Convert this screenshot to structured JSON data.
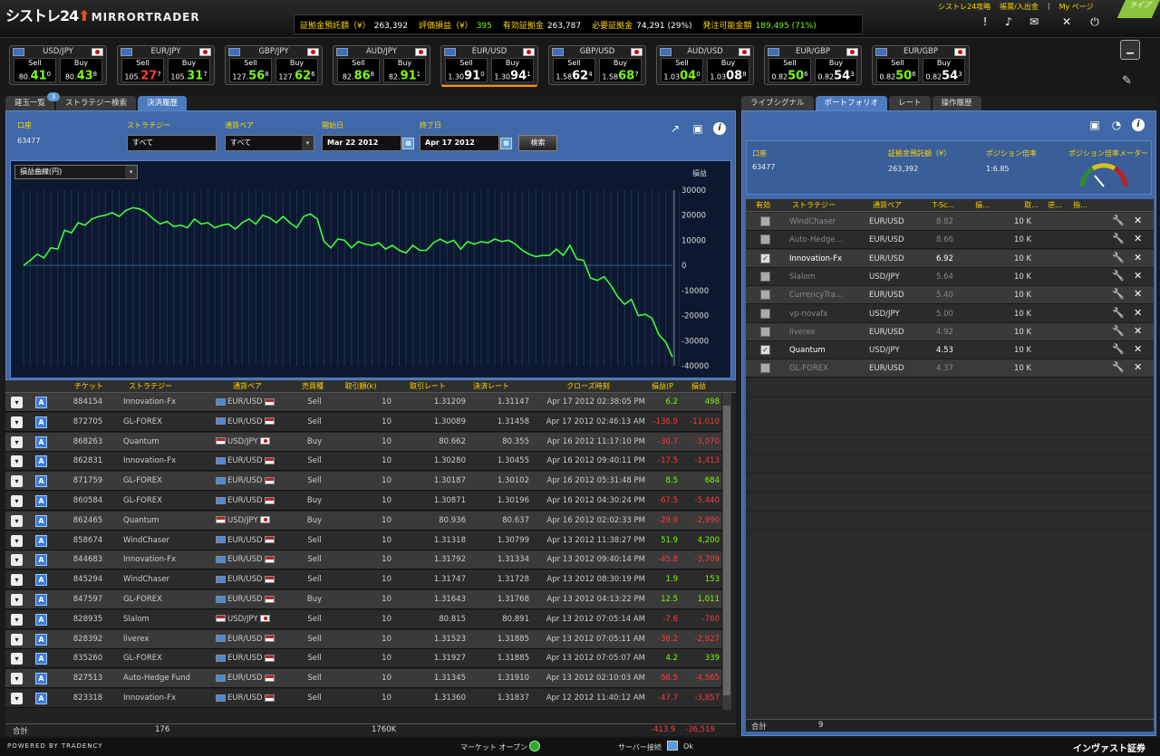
{
  "header": {
    "logo": "シストレ24",
    "logo_sub": "MIRRORTRADER",
    "account_bar": [
      {
        "label": "証拠金預託額（¥）",
        "value": "263,392",
        "green": false
      },
      {
        "label": "評価損益（¥）",
        "value": "395",
        "green": true
      },
      {
        "label": "有効証拠金",
        "value": "263,787",
        "green": false
      },
      {
        "label": "必要証拠金",
        "value": "74,291 (29%)",
        "green": false
      },
      {
        "label": "発注可能金額",
        "value": "189,495 (71%)",
        "green": true
      }
    ],
    "links": [
      "シストレ24攻略",
      "帳票/入出金",
      "|",
      "My ページ"
    ],
    "corner_flag": "ライブ"
  },
  "quotes": [
    {
      "pair": "USD/JPY",
      "sell_pre": "80.",
      "sell_big": "41",
      "sell_sup": "0",
      "buy_pre": "80.",
      "buy_big": "43",
      "buy_sup": "8",
      "sell_color": "g",
      "buy_color": "g",
      "active": false
    },
    {
      "pair": "EUR/JPY",
      "sell_pre": "105.",
      "sell_big": "27",
      "sell_sup": "7",
      "buy_pre": "105.",
      "buy_big": "31",
      "buy_sup": "7",
      "sell_color": "r",
      "buy_color": "g",
      "active": false
    },
    {
      "pair": "GBP/JPY",
      "sell_pre": "127.",
      "sell_big": "56",
      "sell_sup": "8",
      "buy_pre": "127.",
      "buy_big": "62",
      "buy_sup": "6",
      "sell_color": "g",
      "buy_color": "g",
      "active": false
    },
    {
      "pair": "AUD/JPY",
      "sell_pre": "82.",
      "sell_big": "86",
      "sell_sup": "8",
      "buy_pre": "82.",
      "buy_big": "91",
      "buy_sup": "1",
      "sell_color": "g",
      "buy_color": "g",
      "active": false
    },
    {
      "pair": "EUR/USD",
      "sell_pre": "1.30",
      "sell_big": "91",
      "sell_sup": "0",
      "buy_pre": "1.30",
      "buy_big": "94",
      "buy_sup": "1",
      "sell_color": "w",
      "buy_color": "w",
      "active": true
    },
    {
      "pair": "GBP/USD",
      "sell_pre": "1.58",
      "sell_big": "62",
      "sell_sup": "4",
      "buy_pre": "1.58",
      "buy_big": "68",
      "buy_sup": "7",
      "sell_color": "w",
      "buy_color": "g",
      "active": false
    },
    {
      "pair": "AUD/USD",
      "sell_pre": "1.03",
      "sell_big": "04",
      "sell_sup": "0",
      "buy_pre": "1.03",
      "buy_big": "08",
      "buy_sup": "8",
      "sell_color": "g",
      "buy_color": "w",
      "active": false
    },
    {
      "pair": "EUR/GBP",
      "sell_pre": "0.82",
      "sell_big": "50",
      "sell_sup": "6",
      "buy_pre": "0.82",
      "buy_big": "54",
      "buy_sup": "3",
      "sell_color": "g",
      "buy_color": "w",
      "active": false
    },
    {
      "pair": "EUR/GBP",
      "sell_pre": "0.82",
      "sell_big": "50",
      "sell_sup": "6",
      "buy_pre": "0.82",
      "buy_big": "54",
      "buy_sup": "3",
      "sell_color": "g",
      "buy_color": "w",
      "active": false
    }
  ],
  "left": {
    "tabs": [
      "建玉一覧",
      "ストラテジー検索",
      "決済履歴"
    ],
    "tab_badge": "3",
    "filter": {
      "account_label": "口座",
      "account": "63477",
      "strategy_label": "ストラテジー",
      "strategy": "すべて",
      "pair_label": "通貨ペア",
      "pair": "すべて",
      "start_label": "開始日",
      "start": "Mar 22 2012",
      "end_label": "終了日",
      "end": "Apr 17 2012",
      "search": "検索"
    },
    "chart_select": "損益曲線(円)",
    "chart_ylabel": "損益",
    "columns": [
      "チケット",
      "ストラテジー",
      "通貨ペア",
      "売買種",
      "取引額(k)",
      "取引レート",
      "決済レート",
      "クローズ時刻",
      "損益(P",
      "損益"
    ],
    "trades": [
      [
        "884154",
        "Innovation-Fx",
        "EUR/USD",
        "Sell",
        "10",
        "1.31209",
        "1.31147",
        "Apr 17 2012 02:38:05 PM",
        "6.2",
        "498"
      ],
      [
        "872705",
        "GL-FOREX",
        "EUR/USD",
        "Sell",
        "10",
        "1.30089",
        "1.31458",
        "Apr 17 2012 02:46:13 AM",
        "-136.9",
        "-11,010"
      ],
      [
        "868263",
        "Quantum",
        "USD/JPY",
        "Buy",
        "10",
        "80.662",
        "80.355",
        "Apr 16 2012 11:17:10 PM",
        "-30.7",
        "-3,070"
      ],
      [
        "862831",
        "Innovation-Fx",
        "EUR/USD",
        "Sell",
        "10",
        "1.30280",
        "1.30455",
        "Apr 16 2012 09:40:11 PM",
        "-17.5",
        "-1,413"
      ],
      [
        "871759",
        "GL-FOREX",
        "EUR/USD",
        "Sell",
        "10",
        "1.30187",
        "1.30102",
        "Apr 16 2012 05:31:48 PM",
        "8.5",
        "684"
      ],
      [
        "860584",
        "GL-FOREX",
        "EUR/USD",
        "Buy",
        "10",
        "1.30871",
        "1.30196",
        "Apr 16 2012 04:30:24 PM",
        "-67.5",
        "-5,440"
      ],
      [
        "862465",
        "Quantum",
        "USD/JPY",
        "Buy",
        "10",
        "80.936",
        "80.637",
        "Apr 16 2012 02:02:33 PM",
        "-29.9",
        "-2,990"
      ],
      [
        "858674",
        "WindChaser",
        "EUR/USD",
        "Sell",
        "10",
        "1.31318",
        "1.30799",
        "Apr 13 2012 11:38:27 PM",
        "51.9",
        "4,200"
      ],
      [
        "844683",
        "Innovation-Fx",
        "EUR/USD",
        "Sell",
        "10",
        "1.31792",
        "1.31334",
        "Apr 13 2012 09:40:14 PM",
        "-45.8",
        "-3,709"
      ],
      [
        "845294",
        "WindChaser",
        "EUR/USD",
        "Sell",
        "10",
        "1.31747",
        "1.31728",
        "Apr 13 2012 08:30:19 PM",
        "1.9",
        "153"
      ],
      [
        "847597",
        "GL-FOREX",
        "EUR/USD",
        "Buy",
        "10",
        "1.31643",
        "1.31768",
        "Apr 13 2012 04:13:22 PM",
        "12.5",
        "1,011"
      ],
      [
        "828935",
        "Slalom",
        "USD/JPY",
        "Sell",
        "10",
        "80.815",
        "80.891",
        "Apr 13 2012 07:05:14 AM",
        "-7.6",
        "-760"
      ],
      [
        "828392",
        "liverex",
        "EUR/USD",
        "Sell",
        "10",
        "1.31523",
        "1.31885",
        "Apr 13 2012 07:05:11 AM",
        "-36.2",
        "-2,927"
      ],
      [
        "835260",
        "GL-FOREX",
        "EUR/USD",
        "Sell",
        "10",
        "1.31927",
        "1.31885",
        "Apr 13 2012 07:05:07 AM",
        "4.2",
        "339"
      ],
      [
        "827513",
        "Auto-Hedge Fund",
        "EUR/USD",
        "Sell",
        "10",
        "1.31345",
        "1.31910",
        "Apr 13 2012 02:10:03 AM",
        "-56.5",
        "-4,565"
      ],
      [
        "823318",
        "Innovation-Fx",
        "EUR/USD",
        "Sell",
        "10",
        "1.31360",
        "1.31837",
        "Apr 12 2012 11:40:12 AM",
        "-47.7",
        "-3,857"
      ]
    ],
    "totals": {
      "label": "合計",
      "count": "176",
      "amount": "1760K",
      "pips": "-413.9",
      "pl": "-36,519"
    }
  },
  "right": {
    "tabs": [
      "ライブシグナル",
      "ポートフォリオ",
      "レート",
      "操作履歴"
    ],
    "summary": {
      "account_label": "口座",
      "account": "63477",
      "deposit_label": "証拠金預託額（¥）",
      "deposit": "263,392",
      "leverage_label": "ポジション倍率",
      "leverage": "1:6.85",
      "meter_label": "ポジション倍率メーター"
    },
    "columns": [
      "有効",
      "ストラテジー",
      "通貨ペア",
      "T-Sc...",
      "損...",
      "取...",
      "逆...",
      "指..."
    ],
    "strategies": [
      {
        "on": false,
        "name": "WindChaser",
        "pair": "EUR/USD",
        "score": "8.82",
        "amt": "10 K"
      },
      {
        "on": false,
        "name": "Auto-Hedge...",
        "pair": "EUR/USD",
        "score": "8.66",
        "amt": "10 K"
      },
      {
        "on": true,
        "name": "Innovation-Fx",
        "pair": "EUR/USD",
        "score": "6.92",
        "amt": "10 K"
      },
      {
        "on": false,
        "name": "Slalom",
        "pair": "USD/JPY",
        "score": "5.64",
        "amt": "10 K"
      },
      {
        "on": false,
        "name": "CurrencyTra...",
        "pair": "EUR/USD",
        "score": "5.40",
        "amt": "10 K"
      },
      {
        "on": false,
        "name": "vp-novafx",
        "pair": "USD/JPY",
        "score": "5.00",
        "amt": "10 K"
      },
      {
        "on": false,
        "name": "liverex",
        "pair": "EUR/USD",
        "score": "4.92",
        "amt": "10 K"
      },
      {
        "on": true,
        "name": "Quantum",
        "pair": "USD/JPY",
        "score": "4.53",
        "amt": "10 K"
      },
      {
        "on": false,
        "name": "GL-FOREX",
        "pair": "EUR/USD",
        "score": "4.37",
        "amt": "10 K"
      }
    ],
    "totals": {
      "label": "合計",
      "count": "9"
    }
  },
  "footer": {
    "powered": "Powered By Tradency",
    "market": "マーケット オープン",
    "server": "サーバー接続",
    "server_status": "Ok",
    "brand": "インヴァスト証券"
  },
  "chart_data": {
    "type": "line",
    "ylim": [
      -40000,
      30000
    ],
    "yticks": [
      30000,
      20000,
      10000,
      0,
      -10000,
      -20000,
      -30000,
      -40000
    ],
    "values": [
      0,
      2000,
      4500,
      3000,
      7000,
      6500,
      14000,
      13000,
      17000,
      16000,
      18500,
      19500,
      20000,
      21000,
      19500,
      22000,
      23000,
      22500,
      21000,
      18500,
      16500,
      17500,
      15500,
      16000,
      15000,
      18500,
      16500,
      17000,
      15000,
      16000,
      16500,
      14500,
      17000,
      18500,
      16500,
      20000,
      19000,
      17000,
      19500,
      17000,
      15000,
      19500,
      20500,
      18500,
      9500,
      7000,
      10500,
      10000,
      7000,
      9500,
      8500,
      8000,
      9000,
      6500,
      8000,
      6000,
      5000,
      8000,
      6000,
      6000,
      9000,
      10500,
      9000,
      10000,
      6500,
      9500,
      8500,
      9500,
      9000,
      10500,
      9500,
      10000,
      8500,
      6000,
      4500,
      3500,
      4000,
      4000,
      6500,
      4000,
      8000,
      2500,
      2000,
      -5000,
      -6000,
      -4500,
      -8000,
      -12500,
      -15500,
      -13500,
      -20000,
      -19500,
      -21000,
      -27500,
      -30500,
      -36500
    ]
  }
}
